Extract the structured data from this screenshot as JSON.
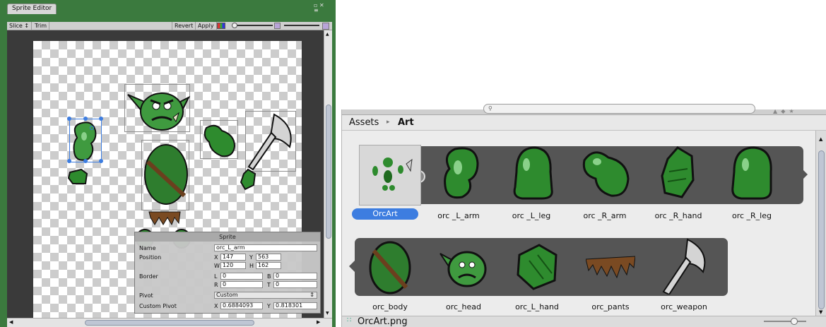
{
  "sprite_editor": {
    "tab_title": "Sprite Editor",
    "toolbar": {
      "slice_label": "Slice ↕",
      "trim_label": "Trim",
      "revert_label": "Revert",
      "apply_label": "Apply"
    },
    "panel": {
      "title": "Sprite",
      "name_label": "Name",
      "name_value": "orc_L_arm",
      "position_label": "Position",
      "x_label": "X",
      "x_value": "147",
      "y_label": "Y",
      "y_value": "563",
      "w_label": "W",
      "w_value": "120",
      "h_label": "H",
      "h_value": "162",
      "border_label": "Border",
      "l_label": "L",
      "l_value": "0",
      "b_label": "B",
      "b_value": "0",
      "r_label": "R",
      "r_value": "0",
      "t_label": "T",
      "t_value": "0",
      "pivot_label": "Pivot",
      "pivot_value": "Custom",
      "custom_pivot_label": "Custom Pivot",
      "cp_x_label": "X",
      "cp_x_value": "0.6884093",
      "cp_y_label": "Y",
      "cp_y_value": "0.818301"
    }
  },
  "project_browser": {
    "breadcrumb": {
      "root": "Assets",
      "separator": "▸",
      "current": "Art"
    },
    "row1": [
      {
        "label": "OrcArt",
        "icon": "orc-sprite-sheet-thumbnail",
        "selected": true
      },
      {
        "label": "orc _L_arm",
        "icon": "arm-sprite"
      },
      {
        "label": "orc _L_leg",
        "icon": "leg-sprite"
      },
      {
        "label": "orc _R_arm",
        "icon": "arm-sprite"
      },
      {
        "label": "orc _R_hand",
        "icon": "hand-sprite"
      },
      {
        "label": "orc _R_leg",
        "icon": "leg-sprite"
      }
    ],
    "row2": [
      {
        "label": "orc_body",
        "icon": "body-sprite"
      },
      {
        "label": "orc_head",
        "icon": "head-sprite"
      },
      {
        "label": "orc_L_hand",
        "icon": "hand-sprite"
      },
      {
        "label": "orc_pants",
        "icon": "pants-sprite"
      },
      {
        "label": "orc_weapon",
        "icon": "axe-sprite"
      }
    ],
    "status_file": "OrcArt.png"
  },
  "colors": {
    "window_frame": "#3b7a3e",
    "orc_green": "#2e8b2e",
    "orc_dark": "#145214",
    "selection_blue": "#3d7de0",
    "strip": "#555555"
  }
}
